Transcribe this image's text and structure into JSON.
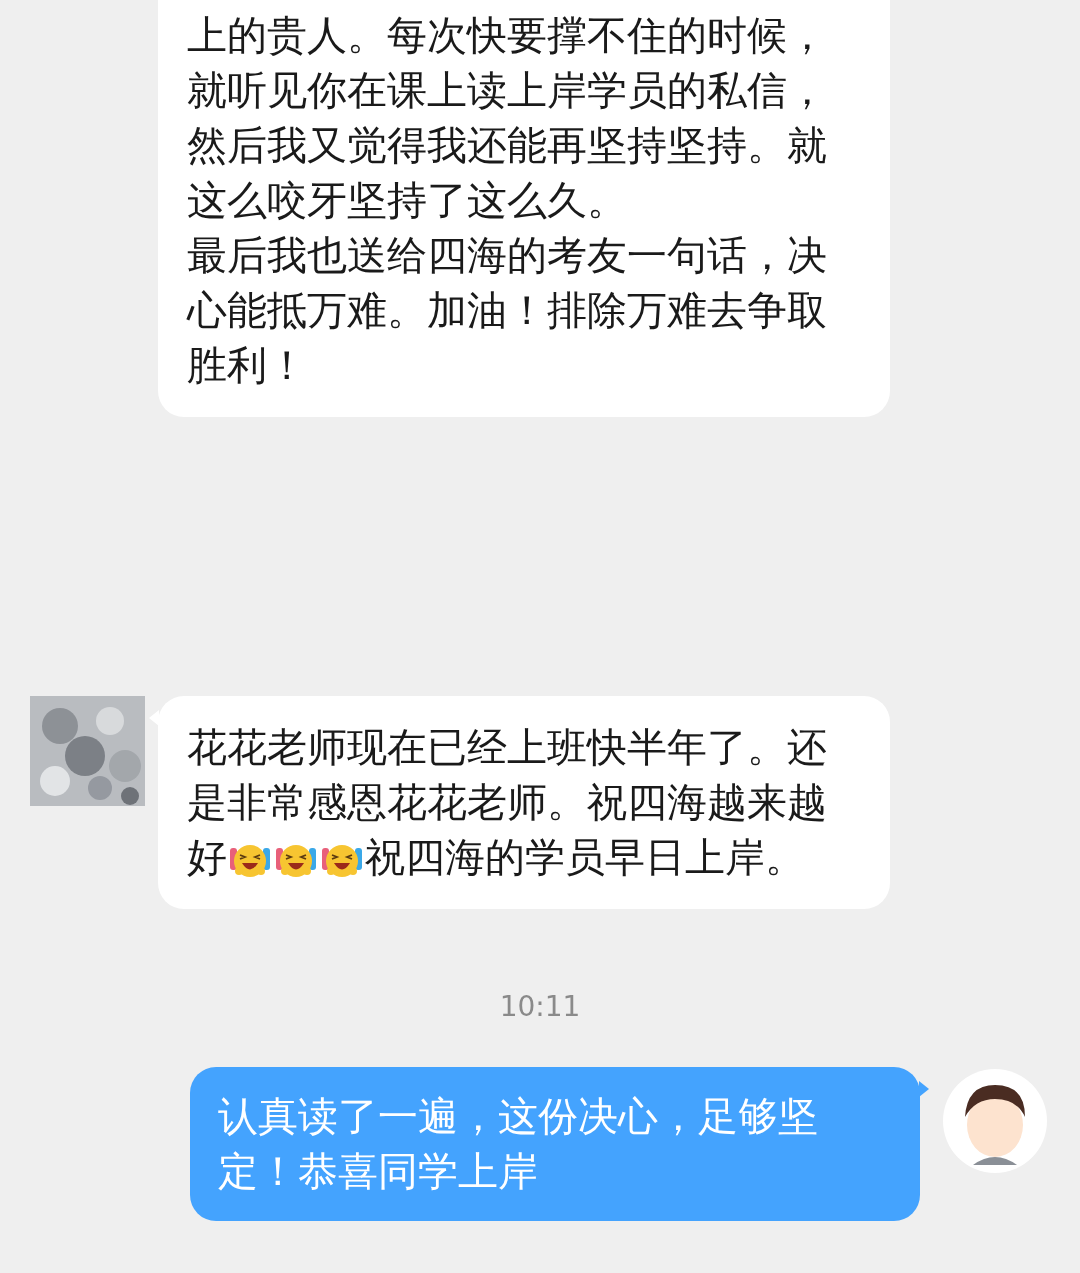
{
  "messages": [
    {
      "kind": "incoming",
      "avatar": false,
      "clipped_top": true,
      "lines": [
        [
          {
            "kind": "text",
            "text": "上的贵人。每次快要撑不住的时候，"
          }
        ],
        [
          {
            "kind": "text",
            "text": "就听见你在课上读上岸学员的私信，"
          }
        ],
        [
          {
            "kind": "text",
            "text": "然后我又觉得我还能再坚持坚持。就"
          }
        ],
        [
          {
            "kind": "text",
            "text": "这么咬牙坚持了这么久。"
          }
        ],
        [
          {
            "kind": "text",
            "text": "最后我也送给四海的考友一句话，决"
          }
        ],
        [
          {
            "kind": "text",
            "text": "心能抵万难。加油！排除万难去争取"
          }
        ],
        [
          {
            "kind": "text",
            "text": "胜利！"
          }
        ]
      ]
    },
    {
      "kind": "incoming",
      "avatar": true,
      "clipped_top": false,
      "lines": [
        [
          {
            "kind": "text",
            "text": "花花老师现在已经上班快半年了。还"
          }
        ],
        [
          {
            "kind": "text",
            "text": "是非常感恩花花老师。祝四海越来越"
          }
        ],
        [
          {
            "kind": "text",
            "text": "好"
          },
          {
            "kind": "emoji"
          },
          {
            "kind": "emoji"
          },
          {
            "kind": "emoji"
          },
          {
            "kind": "text",
            "text": "祝四海的学员早日上岸。"
          }
        ]
      ]
    },
    {
      "kind": "time",
      "text": "10:11"
    },
    {
      "kind": "outgoing",
      "avatar": true,
      "clipped_top": false,
      "lines": [
        [
          {
            "kind": "text",
            "text": "认真读了一遍，这份决心，足够坚"
          }
        ],
        [
          {
            "kind": "text",
            "text": "定！恭喜同学上岸"
          }
        ]
      ]
    }
  ]
}
